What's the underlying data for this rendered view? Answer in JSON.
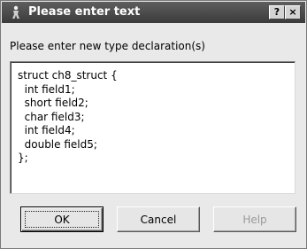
{
  "dialog": {
    "title": "Please enter text",
    "title_buttons": {
      "help": "?",
      "close": "×"
    },
    "prompt": "Please enter new type declaration(s)",
    "text_value": "struct ch8_struct {\n  int field1;\n  short field2;\n  char field3;\n  int field4;\n  double field5;\n};",
    "buttons": {
      "ok": "OK",
      "cancel": "Cancel",
      "help": "Help"
    },
    "help_enabled": false,
    "icons": {
      "title": "app-figure-icon"
    }
  }
}
